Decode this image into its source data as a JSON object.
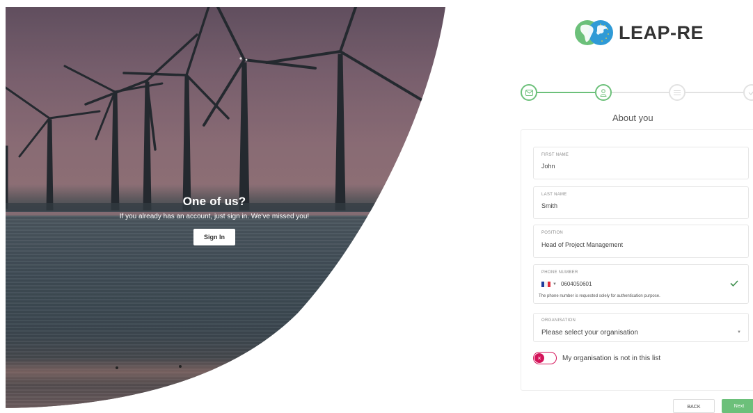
{
  "hero": {
    "title": "One of us?",
    "subtitle": "If you already has an account, just sign in. We've missed you!",
    "signin_label": "Sign In"
  },
  "brand": {
    "name": "LEAP-RE",
    "primary_color": "#6cc07a",
    "accent_color": "#2f9ad6"
  },
  "stepper": {
    "current_step_label": "About you",
    "steps": [
      {
        "icon": "envelope-icon",
        "state": "done"
      },
      {
        "icon": "user-icon",
        "state": "active"
      },
      {
        "icon": "list-icon",
        "state": "pending"
      },
      {
        "icon": "check-icon",
        "state": "pending"
      }
    ]
  },
  "form": {
    "first_name": {
      "label": "FIRST NAME",
      "value": "John"
    },
    "last_name": {
      "label": "LAST NAME",
      "value": "Smith"
    },
    "position": {
      "label": "POSITION",
      "value": "Head of Project Management"
    },
    "phone": {
      "label": "PHONE NUMBER",
      "value": "0604050601",
      "country_flag": "france-flag-icon",
      "help": "The phone number is requested solely for authentication purpose.",
      "valid": true
    },
    "organisation": {
      "label": "ORGANISATION",
      "value": "Please select your organisation"
    },
    "not_in_list": {
      "label": "My organisation is not in this list",
      "checked": false,
      "color": "#d4145a"
    }
  },
  "actions": {
    "back_label": "BACK",
    "next_label": "Next"
  }
}
